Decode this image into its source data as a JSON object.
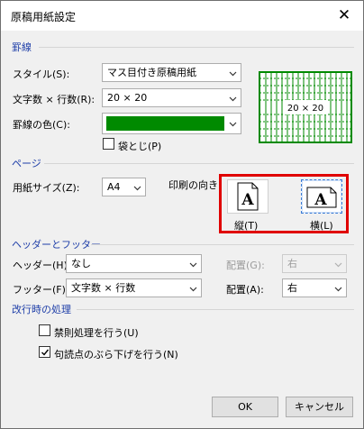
{
  "window": {
    "title": "原稿用紙設定",
    "close_glyph": "✕"
  },
  "ruled": {
    "section_label": "罫線",
    "style_label": "スタイル(S):",
    "style_value": "マス目付き原稿用紙",
    "count_label": "文字数 × 行数(R):",
    "count_value": "20 × 20",
    "color_label": "罫線の色(C):",
    "line_color": "#008a00",
    "bound_label": "袋とじ(P)",
    "bound_checked": false,
    "preview_text": "20 × 20"
  },
  "page": {
    "section_label": "ページ",
    "size_label": "用紙サイズ(Z):",
    "size_value": "A4",
    "orientation_label": "印刷の向き:",
    "portrait_label": "縦(T)",
    "landscape_label": "横(L)",
    "orientation_icon_glyph": "A",
    "selected_orientation": "landscape"
  },
  "header_footer": {
    "section_label": "ヘッダーとフッター",
    "header_label": "ヘッダー(H):",
    "header_value": "なし",
    "header_pos_label": "配置(G):",
    "header_pos_value": "右",
    "footer_label": "フッター(F):",
    "footer_value": "文字数 × 行数",
    "footer_pos_label": "配置(A):",
    "footer_pos_value": "右"
  },
  "line_break": {
    "section_label": "改行時の処理",
    "kinsoku_label": "禁則処理を行う(U)",
    "kinsoku_checked": false,
    "punct_label": "句読点のぶら下げを行う(N)",
    "punct_checked": true
  },
  "buttons": {
    "ok": "OK",
    "cancel": "キャンセル"
  },
  "colors": {
    "section_text": "#1e3ea8",
    "highlight": "#e00000"
  }
}
